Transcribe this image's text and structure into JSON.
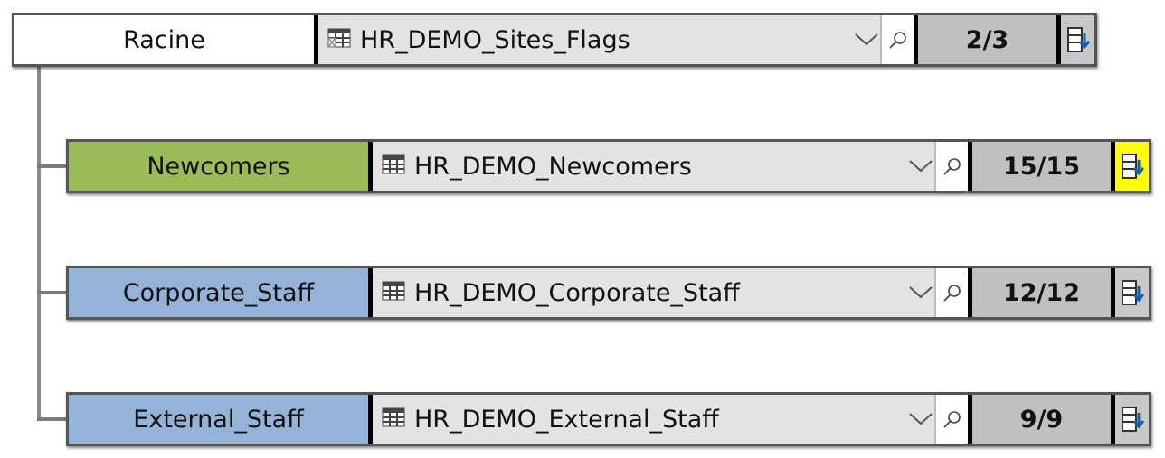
{
  "root": {
    "label": "Racine",
    "table": "HR_DEMO_Sites_Flags",
    "count": "2/3",
    "label_color": "#ffffff",
    "table_icon": "table-filter-icon"
  },
  "children": [
    {
      "label": "Newcomers",
      "table": "HR_DEMO_Newcomers",
      "count": "15/15",
      "label_color": "#9bbb59",
      "export_highlighted": true
    },
    {
      "label": "Corporate_Staff",
      "table": "HR_DEMO_Corporate_Staff",
      "count": "12/12",
      "label_color": "#95b3d7",
      "export_highlighted": false
    },
    {
      "label": "External_Staff",
      "table": "HR_DEMO_External_Staff",
      "count": "9/9",
      "label_color": "#95b3d7",
      "export_highlighted": false
    }
  ],
  "icons": {
    "dropdown": "chevron-down-icon",
    "search": "search-icon",
    "export": "export-list-icon",
    "table": "table-icon"
  }
}
